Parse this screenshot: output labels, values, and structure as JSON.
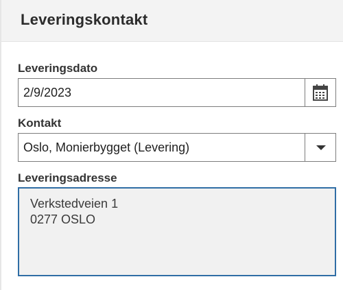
{
  "header": {
    "title": "Leveringskontakt"
  },
  "delivery_date": {
    "label": "Leveringsdato",
    "value": "2/9/2023",
    "icon": "calendar-icon"
  },
  "contact": {
    "label": "Kontakt",
    "value": "Oslo, Monierbygget (Levering)",
    "icon": "chevron-down-icon"
  },
  "address": {
    "label": "Leveringsadresse",
    "lines": [
      "Verkstedveien 1",
      "0277 OSLO"
    ]
  },
  "colors": {
    "header_bg": "#f3f3f3",
    "focus_border": "#2f6da5",
    "textarea_bg": "#f1f1f1"
  }
}
